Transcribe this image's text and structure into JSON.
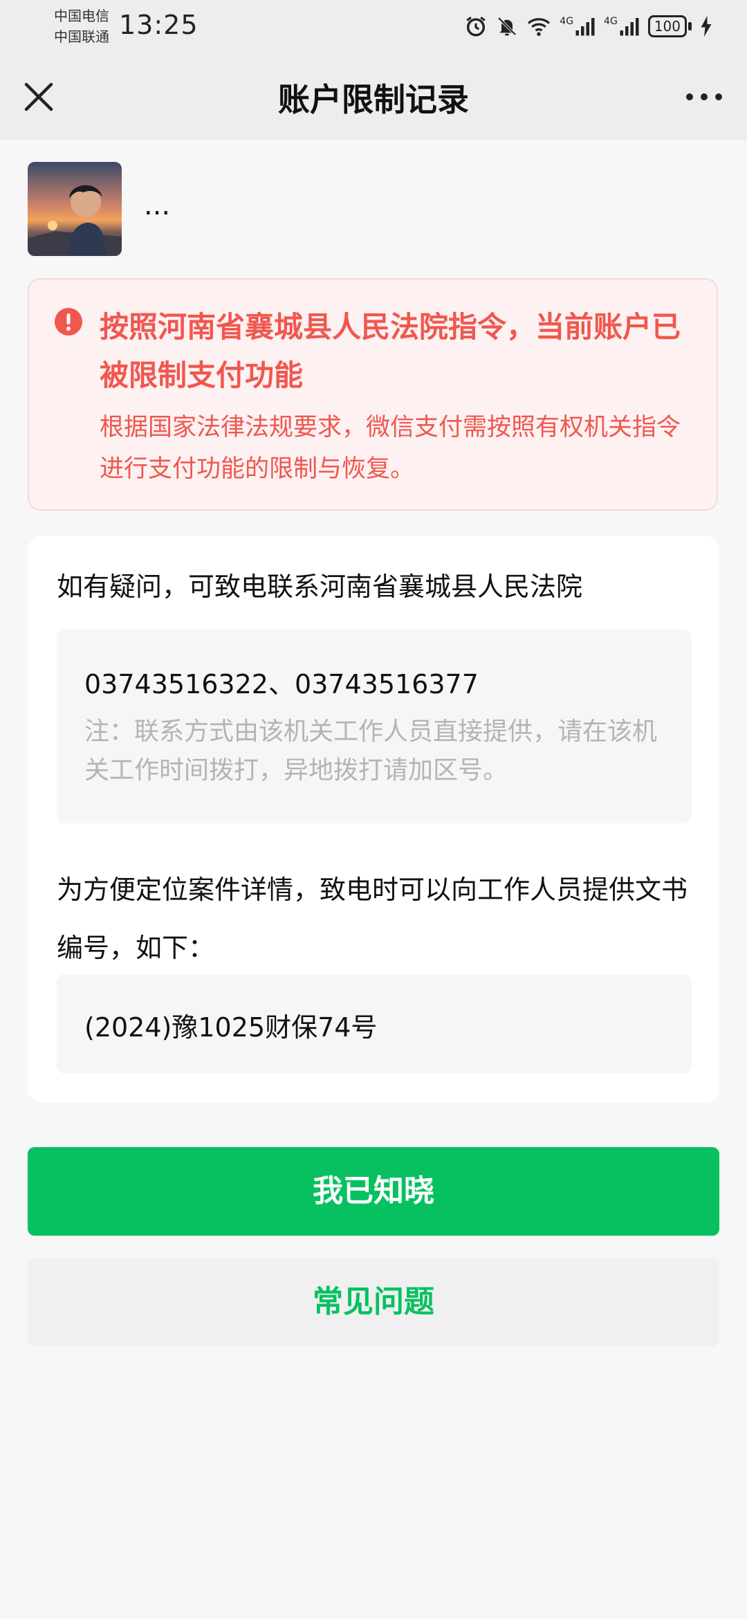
{
  "status_bar": {
    "carrier_1": "中国电信",
    "carrier_2": "中国联通",
    "time": "13:25",
    "network_1": "4G",
    "network_2": "4G",
    "battery": "100"
  },
  "nav": {
    "title": "账户限制记录"
  },
  "user": {
    "name": "..."
  },
  "alert": {
    "title": "按照河南省襄城县人民法院指令，当前账户已被限制支付功能",
    "body": "根据国家法律法规要求，微信支付需按照有权机关指令进行支付功能的限制与恢复。"
  },
  "contact": {
    "intro": "如有疑问，可致电联系河南省襄城县人民法院",
    "phones": "03743516322、03743516377",
    "note": "注：联系方式由该机关工作人员直接提供，请在该机关工作时间拨打，异地拨打请加区号。",
    "doc_intro": "为方便定位案件详情，致电时可以向工作人员提供文书编号，如下：",
    "doc_number": "(2024)豫1025财保74号"
  },
  "buttons": {
    "acknowledge": "我已知晓",
    "faq": "常见问题"
  },
  "colors": {
    "accent_green": "#07c160",
    "alert_red": "#f0574f",
    "alert_bg": "#fdf1f1"
  }
}
